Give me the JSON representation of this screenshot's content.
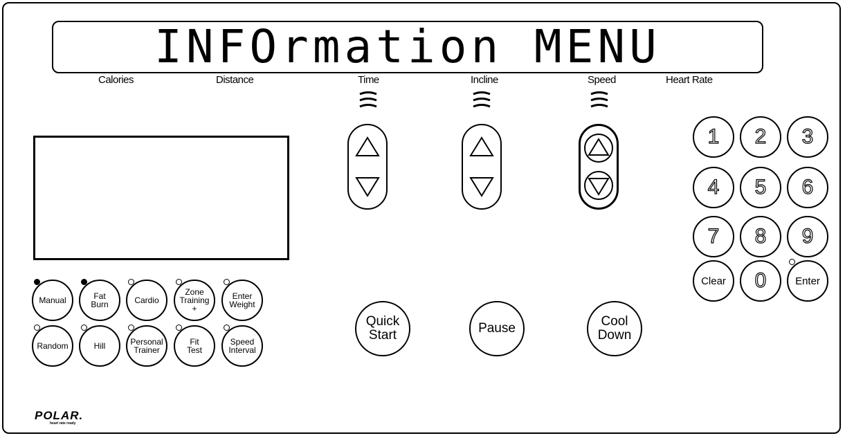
{
  "display": {
    "text": "INFOrmation MENU"
  },
  "labels": {
    "calories": "Calories",
    "distance": "Distance",
    "time": "Time",
    "incline": "Incline",
    "speed": "Speed",
    "heart_rate": "Heart Rate"
  },
  "programs": [
    {
      "label": "Manual",
      "led_on": true
    },
    {
      "label": "Fat\nBurn",
      "led_on": true
    },
    {
      "label": "Cardio",
      "led_on": false
    },
    {
      "label": "Zone\nTraining\n+",
      "led_on": false
    },
    {
      "label": "Enter\nWeight",
      "led_on": false
    },
    {
      "label": "Random",
      "led_on": false
    },
    {
      "label": "Hill",
      "led_on": false
    },
    {
      "label": "Personal\nTrainer",
      "led_on": false
    },
    {
      "label": "Fit\nTest",
      "led_on": false
    },
    {
      "label": "Speed\nInterval",
      "led_on": false
    }
  ],
  "actions": {
    "quick_start": "Quick\nStart",
    "pause": "Pause",
    "cool_down": "Cool\nDown"
  },
  "keypad": {
    "k1": "1",
    "k2": "2",
    "k3": "3",
    "k4": "4",
    "k5": "5",
    "k6": "6",
    "k7": "7",
    "k8": "8",
    "k9": "9",
    "clear": "Clear",
    "k0": "0",
    "enter": "Enter"
  },
  "logo": {
    "brand": "POLAR.",
    "tagline": "heart rate ready"
  }
}
